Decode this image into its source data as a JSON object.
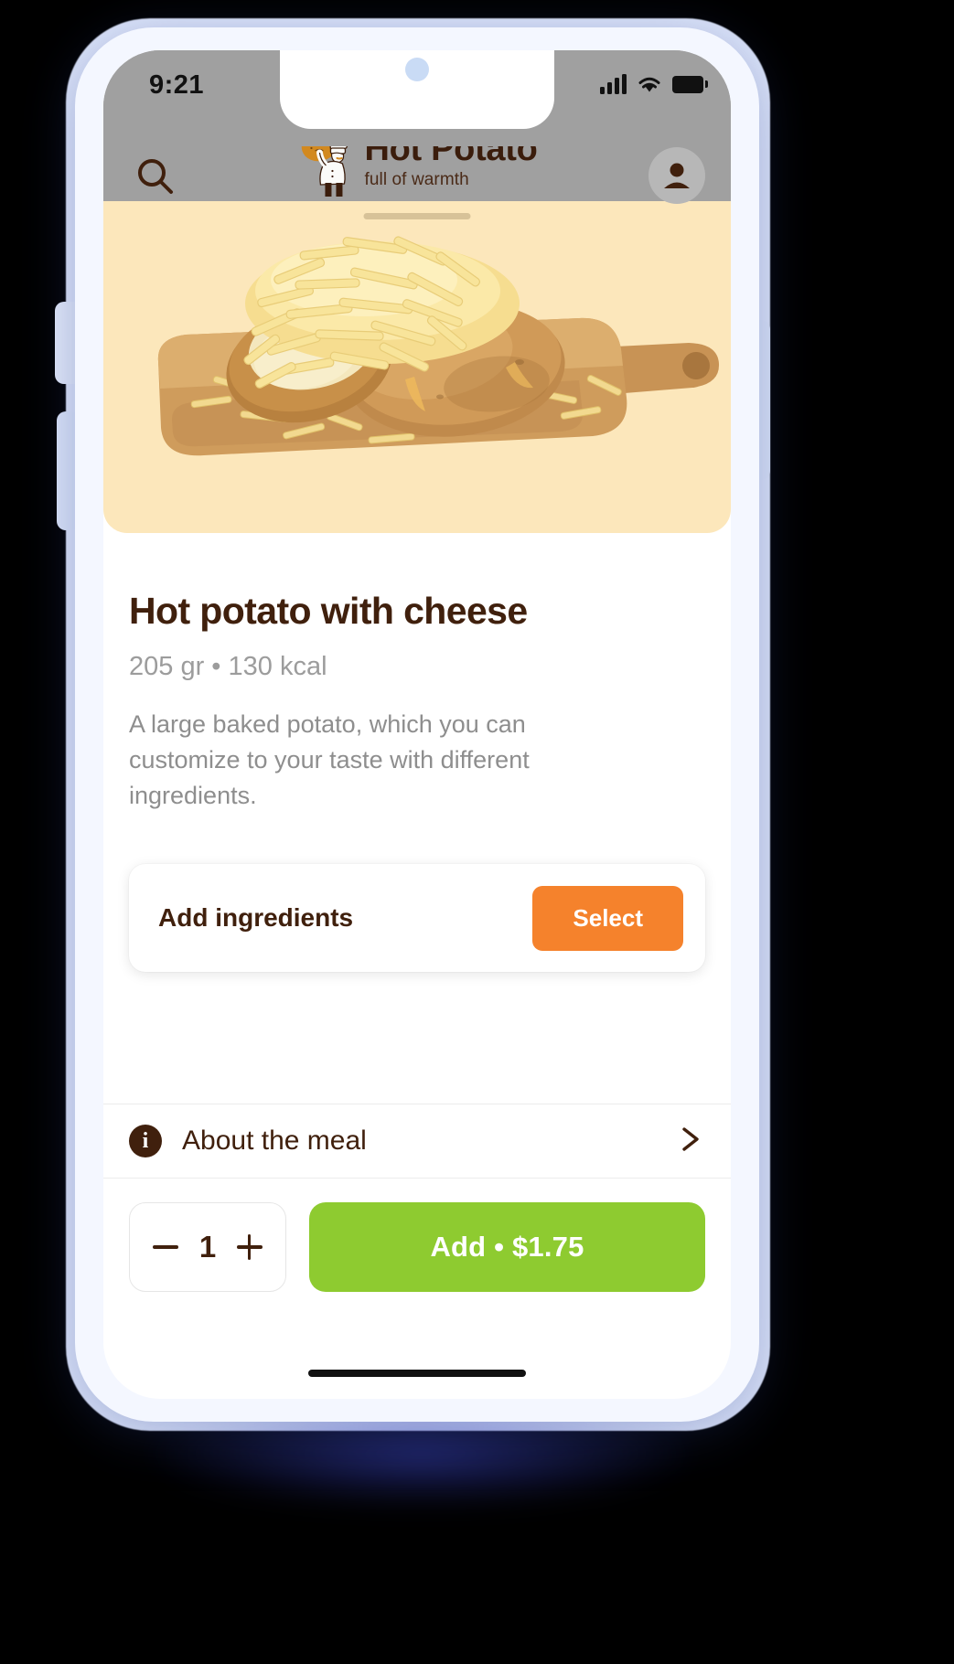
{
  "status_bar": {
    "time": "9:21",
    "signal_icon": "cellular-signal-icon",
    "wifi_icon": "wifi-icon",
    "battery_icon": "battery-full-icon"
  },
  "header": {
    "search_icon": "search-icon",
    "brand_title": "Hot Potato",
    "brand_tagline": "full of warmth",
    "logo_icon": "chef-with-potato-mascot-icon",
    "avatar_icon": "user-avatar-icon",
    "background_color": "#a0a0a0"
  },
  "hero": {
    "background_color": "#fce7bb",
    "image_alt": "baked-potato-with-cheese-on-cutting-board",
    "grabber": "drag-handle"
  },
  "product": {
    "title": "Hot potato with cheese",
    "weight": "205 gr",
    "separator": "•",
    "calories": "130 kcal",
    "meta": "205 gr  •  130 kcal",
    "description": "A large baked potato, which you can customize to your taste with different ingredients."
  },
  "ingredients_card": {
    "label": "Add ingredients",
    "button_label": "Select",
    "button_color": "#f5822c"
  },
  "about_row": {
    "icon": "info-icon",
    "label": "About the meal",
    "chevron_icon": "chevron-right-icon"
  },
  "bottom_bar": {
    "decrement_icon": "minus-icon",
    "quantity": "1",
    "increment_icon": "plus-icon",
    "add_button_label": "Add • $1.75",
    "add_button_color": "#8ecb30",
    "price": "$1.75"
  }
}
